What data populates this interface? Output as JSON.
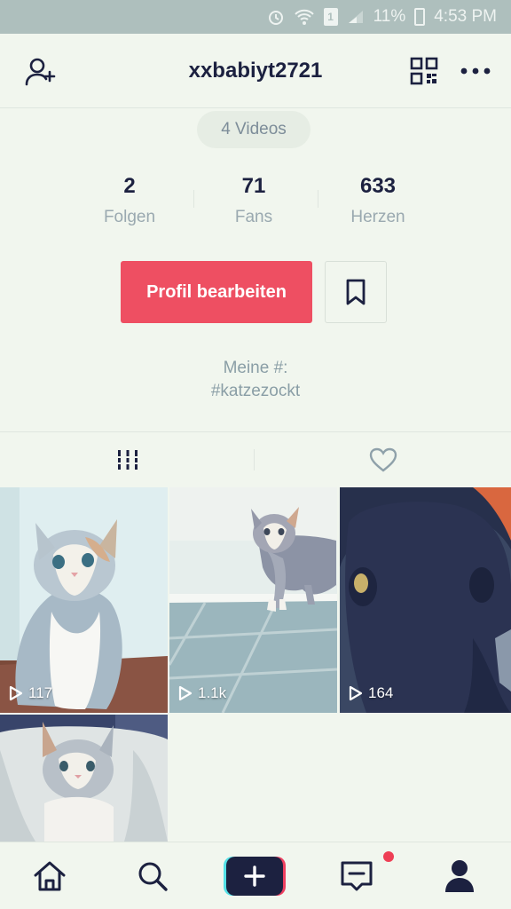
{
  "status_bar": {
    "battery_text": "11%",
    "time": "4:53 PM",
    "sim_label": "1"
  },
  "header": {
    "username": "xxbabiyt2721",
    "icons": [
      "add-user-icon",
      "qr-code-icon",
      "more-icon"
    ]
  },
  "profile": {
    "videos_pill": "4 Videos",
    "stats": [
      {
        "value": "2",
        "label": "Folgen"
      },
      {
        "value": "71",
        "label": "Fans"
      },
      {
        "value": "633",
        "label": "Herzen"
      }
    ],
    "edit_button_label": "Profil bearbeiten",
    "bio_line1": "Meine #:",
    "bio_line2": "#katzezockt"
  },
  "tabs": [
    {
      "name": "videos",
      "icon": "grid-icon"
    },
    {
      "name": "liked",
      "icon": "heart-icon"
    }
  ],
  "videos": [
    {
      "views": "117"
    },
    {
      "views": "1.1k"
    },
    {
      "views": "164"
    },
    {
      "views": ""
    }
  ],
  "bottom_nav": {
    "items": [
      "home-icon",
      "search-icon",
      "create-icon",
      "inbox-icon",
      "profile-icon"
    ],
    "accent": "#ee4f62",
    "notification_dot": "#ee3f55"
  }
}
